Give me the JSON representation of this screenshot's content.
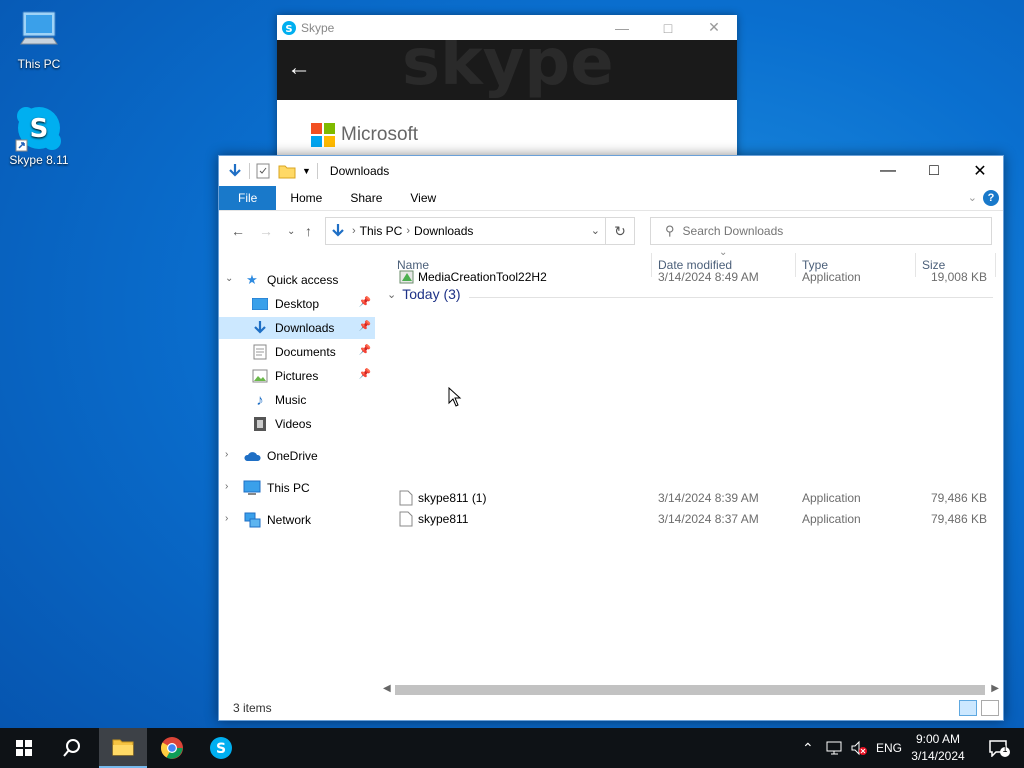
{
  "desktop": {
    "icons": [
      {
        "label": "This PC"
      },
      {
        "label": "Skype 8.11"
      }
    ]
  },
  "skype": {
    "title": "Skype",
    "brand": "Microsoft"
  },
  "explorer": {
    "title": "Downloads",
    "ribbon_tabs": [
      "File",
      "Home",
      "Share",
      "View"
    ],
    "breadcrumb": [
      "This PC",
      "Downloads"
    ],
    "search_placeholder": "Search Downloads",
    "nav_pane": {
      "quick_access": "Quick access",
      "items": [
        "Desktop",
        "Downloads",
        "Documents",
        "Pictures",
        "Music",
        "Videos"
      ],
      "onedrive": "OneDrive",
      "this_pc": "This PC",
      "network": "Network"
    },
    "columns": [
      "Name",
      "Date modified",
      "Type",
      "Size"
    ],
    "group": "Today (3)",
    "files": [
      {
        "name": "MediaCreationTool22H2",
        "date": "3/14/2024 8:49 AM",
        "type": "Application",
        "size": "19,008 KB"
      },
      {
        "name": "skype811 (1)",
        "date": "3/14/2024 8:39 AM",
        "type": "Application",
        "size": "79,486 KB"
      },
      {
        "name": "skype811",
        "date": "3/14/2024 8:37 AM",
        "type": "Application",
        "size": "79,486 KB"
      }
    ],
    "status": "3 items"
  },
  "taskbar": {
    "language": "ENG",
    "time": "9:00 AM",
    "date": "3/14/2024",
    "notification_count": "1"
  },
  "colors": {
    "accent": "#1979ca",
    "selection": "#cce8ff",
    "taskbar": "#0e1216",
    "skype_blue": "#00aff0"
  }
}
